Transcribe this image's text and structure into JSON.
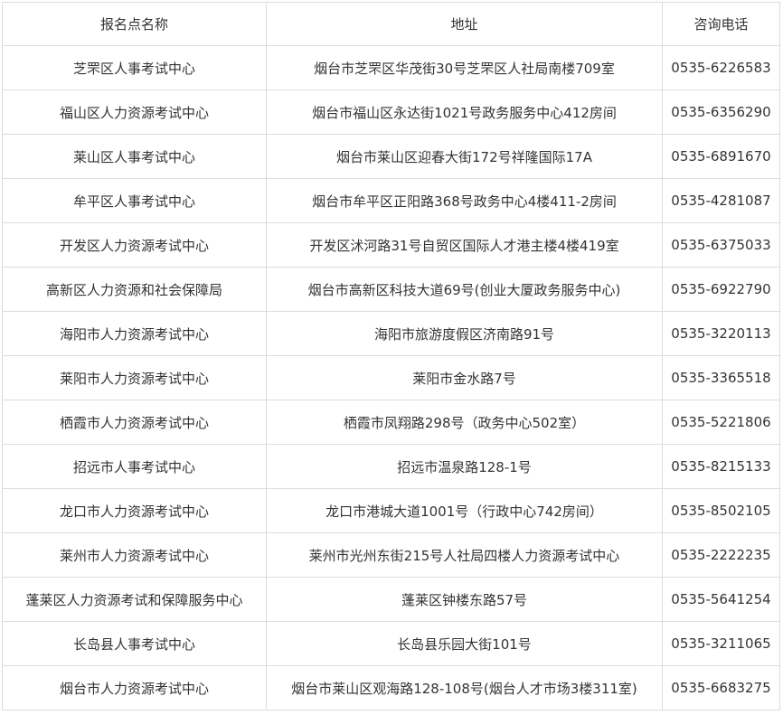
{
  "table": {
    "headers": [
      "报名点名称",
      "地址",
      "咨询电话"
    ],
    "rows": [
      [
        "芝罘区人事考试中心",
        "烟台市芝罘区华茂街30号芝罘区人社局南楼709室",
        "0535-6226583"
      ],
      [
        "福山区人力资源考试中心",
        "烟台市福山区永达街1021号政务服务中心412房间",
        "0535-6356290"
      ],
      [
        "莱山区人事考试中心",
        "烟台市莱山区迎春大街172号祥隆国际17A",
        "0535-6891670"
      ],
      [
        "牟平区人事考试中心",
        "烟台市牟平区正阳路368号政务中心4楼411-2房间",
        "0535-4281087"
      ],
      [
        "开发区人力资源考试中心",
        "开发区沭河路31号自贸区国际人才港主楼4楼419室",
        "0535-6375033"
      ],
      [
        "高新区人力资源和社会保障局",
        "烟台市高新区科技大道69号(创业大厦政务服务中心)",
        "0535-6922790"
      ],
      [
        "海阳市人力资源考试中心",
        "海阳市旅游度假区济南路91号",
        "0535-3220113"
      ],
      [
        "莱阳市人力资源考试中心",
        "莱阳市金水路7号",
        "0535-3365518"
      ],
      [
        "栖霞市人力资源考试中心",
        "栖霞市凤翔路298号（政务中心502室）",
        "0535-5221806"
      ],
      [
        "招远市人事考试中心",
        "招远市温泉路128-1号",
        "0535-8215133"
      ],
      [
        "龙口市人力资源考试中心",
        "龙口市港城大道1001号（行政中心742房间）",
        "0535-8502105"
      ],
      [
        "莱州市人力资源考试中心",
        "莱州市光州东街215号人社局四楼人力资源考试中心",
        "0535-2222235"
      ],
      [
        "蓬莱区人力资源考试和保障服务中心",
        "蓬莱区钟楼东路57号",
        "0535-5641254"
      ],
      [
        "长岛县人事考试中心",
        "长岛县乐园大街101号",
        "0535-3211065"
      ],
      [
        "烟台市人力资源考试中心",
        "烟台市莱山区观海路128-108号(烟台人才市场3楼311室)",
        "0535-6683275"
      ]
    ]
  }
}
